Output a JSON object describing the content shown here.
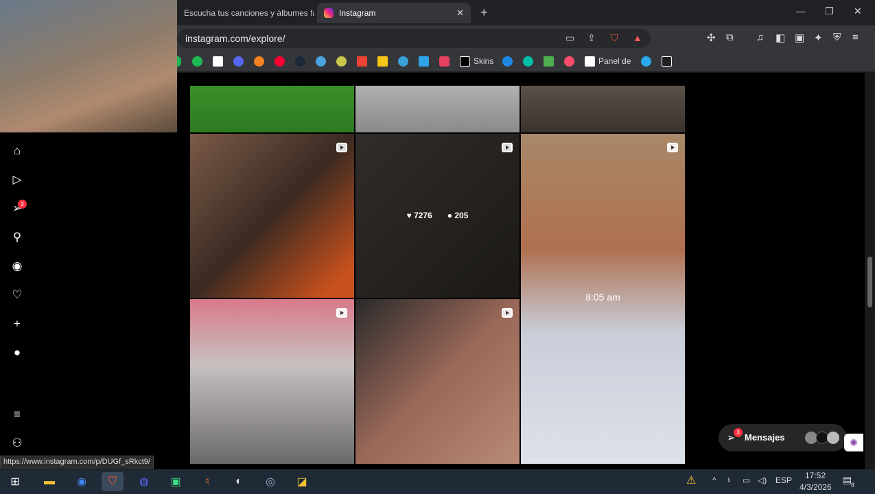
{
  "tabs": {
    "inactive_label": "Escucha tus canciones y álbumes fav",
    "active_label": "Instagram",
    "close_symbol": "✕",
    "new_tab_symbol": "+"
  },
  "window_controls": {
    "minimize": "—",
    "restore": "❐",
    "close": "✕"
  },
  "address_bar": {
    "url": "instagram.com/explore/"
  },
  "bookmarks": {
    "skins_label": "Skins",
    "panel_label": "Panel de"
  },
  "sidebar": {
    "notifications_count": "3"
  },
  "posts": [
    {
      "reel": false
    },
    {
      "reel": false
    },
    {
      "reel": false
    },
    {
      "reel": true
    },
    {
      "reel": true,
      "likes": "7276",
      "comments": "205"
    },
    {
      "reel": true,
      "timestamp": "8:05 am"
    },
    {
      "reel": true
    },
    {
      "reel": true
    },
    {
      "reel": false
    }
  ],
  "messages": {
    "label": "Mensajes",
    "count": "3"
  },
  "status_url": "https://www.instagram.com/p/DUGf_sRkct9/",
  "taskbar": {
    "language": "ESP",
    "time": "17:52",
    "date": "4/3/2026",
    "notification_count": "8"
  }
}
